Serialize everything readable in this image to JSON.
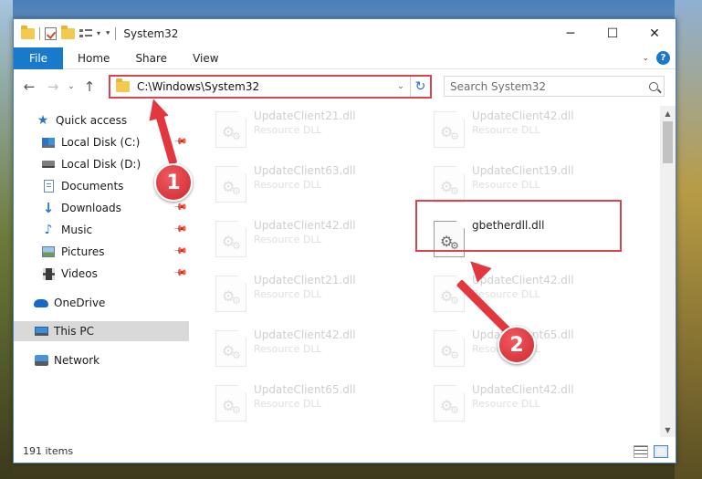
{
  "window": {
    "title": "System32",
    "controls": {
      "minimize": "─",
      "maximize": "☐",
      "close": "✕"
    }
  },
  "ribbon": {
    "tabs": [
      "File",
      "Home",
      "Share",
      "View"
    ],
    "help": "?"
  },
  "navigation": {
    "address": "C:\\Windows\\System32",
    "search_placeholder": "Search System32"
  },
  "sidebar": {
    "items": [
      {
        "label": "Quick access",
        "icon": "star-icon"
      },
      {
        "label": "Local Disk (C:)",
        "icon": "windows-drive-icon",
        "pinned": true
      },
      {
        "label": "Local Disk (D:)",
        "icon": "drive-icon",
        "pinned": false
      },
      {
        "label": "Documents",
        "icon": "documents-icon",
        "pinned": true
      },
      {
        "label": "Downloads",
        "icon": "downloads-icon",
        "pinned": true
      },
      {
        "label": "Music",
        "icon": "music-icon",
        "pinned": true
      },
      {
        "label": "Pictures",
        "icon": "pictures-icon",
        "pinned": true
      },
      {
        "label": "Videos",
        "icon": "videos-icon",
        "pinned": true
      },
      {
        "label": "OneDrive",
        "icon": "onedrive-icon"
      },
      {
        "label": "This PC",
        "icon": "this-pc-icon",
        "selected": true
      },
      {
        "label": "Network",
        "icon": "network-icon"
      }
    ]
  },
  "files": {
    "column1": [
      {
        "name": "UpdateClient21.dll",
        "type": "Resource DLL"
      },
      {
        "name": "UpdateClient63.dll",
        "type": "Resource DLL"
      },
      {
        "name": "UpdateClient42.dll",
        "type": "Resource DLL"
      },
      {
        "name": "UpdateClient21.dll",
        "type": "Resource DLL"
      },
      {
        "name": "UpdateClient42.dll",
        "type": "Resource DLL"
      },
      {
        "name": "UpdateClient65.dll",
        "type": "Resource DLL"
      }
    ],
    "column2": [
      {
        "name": "UpdateClient42.dll",
        "type": "Resource DLL"
      },
      {
        "name": "UpdateClient19.dll",
        "type": "Resource DLL"
      },
      {
        "name": "gbetherdll.dll",
        "type": "",
        "highlighted": true
      },
      {
        "name": "UpdateClient42.dll",
        "type": "Resource DLL"
      },
      {
        "name": "UpdateClient65.dll",
        "type": "Resource DLL"
      },
      {
        "name": "UpdateClient42.dll",
        "type": "Resource DLL"
      }
    ]
  },
  "status": {
    "count": "191 items"
  },
  "annotations": {
    "badge1": "1",
    "badge2": "2"
  },
  "colors": {
    "accent": "#1979ca",
    "annotation_red": "#e2373f",
    "selection": "#d9d9d9"
  }
}
